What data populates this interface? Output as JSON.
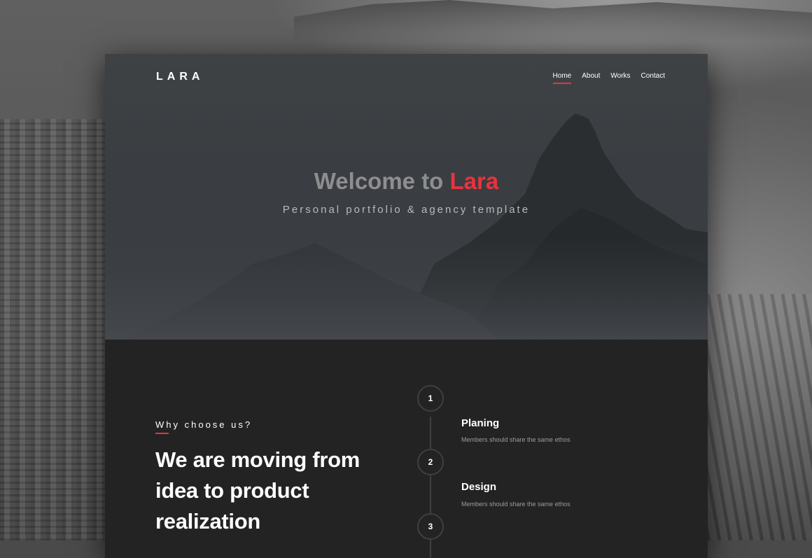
{
  "brand": {
    "logo": "LARA"
  },
  "nav": {
    "items": [
      {
        "label": "Home",
        "active": true
      },
      {
        "label": "About",
        "active": false
      },
      {
        "label": "Works",
        "active": false
      },
      {
        "label": "Contact",
        "active": false
      }
    ]
  },
  "hero": {
    "title_prefix": "Welcome to",
    "title_accent": "Lara",
    "subtitle": "Personal portfolio & agency template"
  },
  "features": {
    "eyebrow": "Why choose us?",
    "headline": "We are moving from idea to product realization",
    "steps": [
      {
        "number": "1",
        "title": "Planing",
        "description": "Members should share the same ethos"
      },
      {
        "number": "2",
        "title": "Design",
        "description": "Members should share the same ethos"
      },
      {
        "number": "3",
        "title": "",
        "description": ""
      }
    ]
  },
  "colors": {
    "accent": "#e8333f",
    "hero_bg": "#3c3f43",
    "section_bg": "#232323"
  }
}
